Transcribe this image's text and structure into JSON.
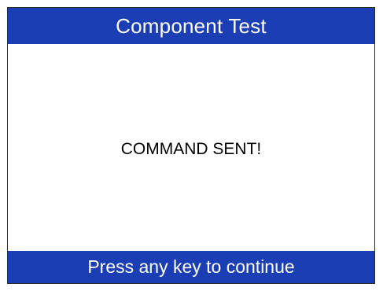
{
  "header": {
    "title": "Component Test"
  },
  "main": {
    "message": "COMMAND SENT!"
  },
  "footer": {
    "prompt": "Press any key to continue"
  },
  "colors": {
    "bar_background": "#1b3eb5",
    "bar_text": "#ffffff",
    "content_background": "#ffffff",
    "message_text": "#000000"
  }
}
